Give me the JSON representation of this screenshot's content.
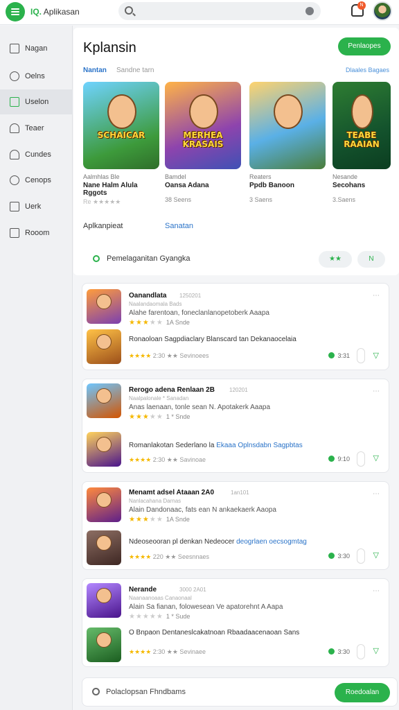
{
  "header": {
    "app_prefix": "IQ.",
    "app_name": "Aplikasan",
    "notification_badge": "N"
  },
  "sidebar": {
    "items": [
      {
        "label": "Nagan"
      },
      {
        "label": "Oelns"
      },
      {
        "label": "Uselon"
      },
      {
        "label": "Teaer"
      },
      {
        "label": "Cundes"
      },
      {
        "label": "Cenops"
      },
      {
        "label": "Uerk"
      },
      {
        "label": "Rooom"
      }
    ]
  },
  "featured": {
    "title": "Kplansin",
    "button": "Penlaopes",
    "tab_label": "Nantan",
    "tab_sub": "Sandne  tarn",
    "right_link": "Dlaales  Bagaes",
    "cards": [
      {
        "art_text": "SCHAICAR",
        "meta": "Aalmhlas           Ble",
        "name": "Nane Halm Alula Rggots",
        "stars": "Re ★★★★★"
      },
      {
        "art_text": "MERHEA KRASAIS",
        "meta": "Bamdel",
        "name": "Oansa Adana",
        "size": "38 Seens"
      },
      {
        "art_text": "",
        "meta": "Reaters",
        "name": "Ppdb Banoon",
        "size": "3 Saens"
      },
      {
        "art_text": "TEABE RAAIAN",
        "meta": "Nesande",
        "name": "Secohans",
        "size": "3.Saens"
      }
    ],
    "foot_left": "Aplkanpieat",
    "foot_right": "Sanatan",
    "filter_text": "Pemelaganitan  Gyangka",
    "pill_1": "★★",
    "pill_2": "N"
  },
  "list": [
    {
      "title": "Oanandlata",
      "date": "1250201",
      "small_1": "Naalandaomala       Bads",
      "desc": "Alahe farentoan, foneclanlanopetoberk Aaapa",
      "rating_num": "1A Snde",
      "desc2": "Ronaoloan Sagpdiaclary Blanscard tan Dekanaocelaia",
      "desc2_link": "",
      "rate2_num": "2:30 ★★ Sevinoees",
      "size": "3:31",
      "get": "▽"
    },
    {
      "title": "Rerogo adena Renlaan 2B",
      "date": "120201",
      "small_1": "Naalpalonale  * Sanadan",
      "desc": "Anas laenaan, tonle sean N. Apotakerk Aaapa",
      "rating_num": "1 * Snde",
      "desc2": "Romanlakotan Sederlano la",
      "desc2_link": "Ekaaa Oplnsdabn Sagpbtas",
      "rate2_num": "2:30 ★★ Savinoae",
      "size": "9:10",
      "get": "▽"
    },
    {
      "title": "Menamt adsel Ataaan 2A0",
      "date": "1an101",
      "small_1": "Nanlacahana        Darnas",
      "desc": "Alain Dandonaac, fats ean N ankaekaerk Aaopa",
      "rating_num": "1A Snde",
      "desc2": "Ndeoseooran pl denkan Nedeocer",
      "desc2_link": "deogrlaen oecsogmtag",
      "rate2_num": "220 ★★ Seesnnaes",
      "size": "3:30",
      "get": "▽"
    },
    {
      "title": "Nerande",
      "date": "3000 2A01",
      "small_1": "Naanaanoaas   Canaonaal",
      "desc": "Alain Sa fianan, folowesean Ve apatorehnt A Aapa",
      "rating_num": "1 * Sude",
      "desc2": "O Bnpaon Dentaneslcakatnoan Rbaadaacenaoan Sans",
      "desc2_link": "",
      "rate2_num": "2:30 ★★ Sevinaee",
      "size": "3:30",
      "get": "▽"
    }
  ],
  "bottom": {
    "search_text": "Polaclopsan Fhndbams",
    "button": "Roedoalan"
  },
  "colors": {
    "accent": "#2bb24c",
    "link": "#2a73c8",
    "star": "#f5b800"
  }
}
